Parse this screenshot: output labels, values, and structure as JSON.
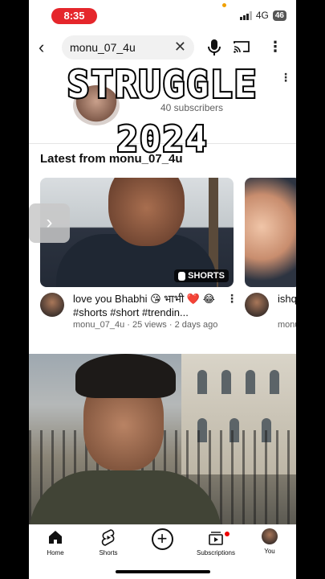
{
  "status_bar": {
    "time": "8:35",
    "network": "4G",
    "battery": "46"
  },
  "search": {
    "query": "monu_07_4u"
  },
  "channel": {
    "subscribers": "40 subscribers"
  },
  "overlay": {
    "line1": "STRUGGLE",
    "line2": "2024"
  },
  "section": {
    "title": "Latest from monu_07_4u"
  },
  "videos": [
    {
      "title": "love you Bhabhi 😘 भाभी ❤️ 😂 #shorts #short #trendin...",
      "meta": "monu_07_4u · 25 views · 2 days ago",
      "badge": "SHORTS"
    },
    {
      "title": "ishq yaar",
      "meta": "monu"
    }
  ],
  "bottom_nav": [
    {
      "label": "Home",
      "icon": "home-icon"
    },
    {
      "label": "Shorts",
      "icon": "shorts-icon"
    },
    {
      "label": "",
      "icon": "create-plus-icon"
    },
    {
      "label": "Subscriptions",
      "icon": "subscriptions-icon"
    },
    {
      "label": "You",
      "icon": "you-avatar"
    }
  ],
  "colors": {
    "time_pill": "#e5262b",
    "accent_red": "#ff0000",
    "text": "#0f0f0f",
    "muted": "#606060"
  }
}
